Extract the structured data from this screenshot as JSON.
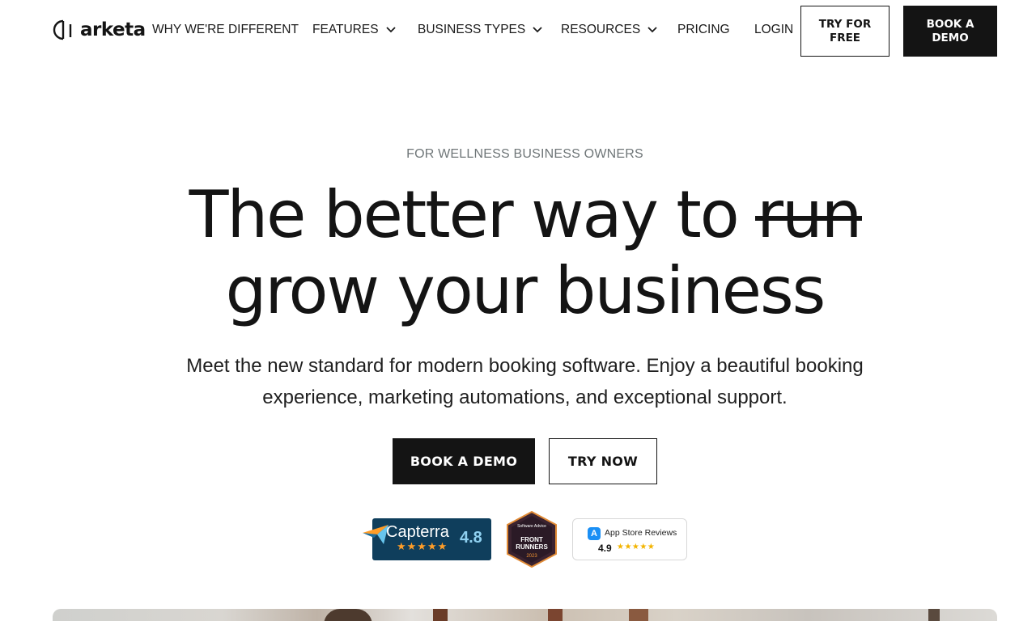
{
  "brand": {
    "name": "arketa"
  },
  "nav": {
    "items": [
      {
        "label": "WHY WE'RE DIFFERENT",
        "has_dropdown": false
      },
      {
        "label": "FEATURES",
        "has_dropdown": true
      },
      {
        "label": "BUSINESS TYPES",
        "has_dropdown": true
      },
      {
        "label": "RESOURCES",
        "has_dropdown": true
      },
      {
        "label": "PRICING",
        "has_dropdown": false
      },
      {
        "label": "LOGIN",
        "has_dropdown": false
      }
    ],
    "try_free_label": "TRY FOR FREE",
    "book_demo_label": "BOOK A DEMO"
  },
  "hero": {
    "eyebrow": "FOR WELLNESS BUSINESS OWNERS",
    "headline_prefix": "The better way to",
    "headline_struck": "run",
    "headline_line2": "grow your business",
    "subheadline": "Meet the new standard for modern booking software. Enjoy a beautiful booking experience, marketing automations, and exceptional support.",
    "primary_cta": "BOOK A DEMO",
    "secondary_cta": "TRY NOW"
  },
  "badges": {
    "capterra": {
      "name": "Capterra",
      "score": "4.8",
      "stars": "★★★★★"
    },
    "software_advice": {
      "top": "Software Advice",
      "title": "FRONT RUNNERS",
      "year": "2023"
    },
    "app_store": {
      "label": "App Store Reviews",
      "score": "4.9",
      "stars": "★★★★★"
    }
  },
  "colors": {
    "primary": "#141414",
    "muted": "#6f7678",
    "capterra_bg": "#0f3e5c",
    "star": "#ff9d28"
  }
}
